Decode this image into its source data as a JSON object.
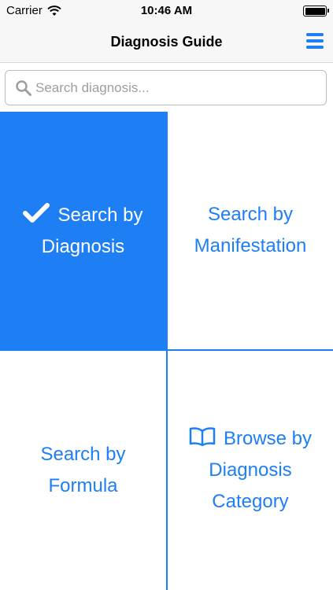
{
  "status_bar": {
    "carrier": "Carrier",
    "time": "10:46 AM",
    "wifi_icon": "wifi-icon",
    "battery_level": 1.0
  },
  "nav": {
    "title": "Diagnosis Guide",
    "menu_icon": "hamburger-menu-icon"
  },
  "search": {
    "placeholder": "Search diagnosis...",
    "value": "",
    "icon": "search-icon"
  },
  "tiles": [
    {
      "line1": "Search by",
      "line2": "Diagnosis",
      "icon": "checkmark-icon",
      "selected": true
    },
    {
      "line1": "Search by",
      "line2": "Manifestation",
      "selected": false
    },
    {
      "line1": "Search by",
      "line2": "Formula",
      "selected": false
    },
    {
      "line1": "Browse by",
      "line2": "Diagnosis",
      "line3": "Category",
      "icon": "book-icon",
      "selected": false
    }
  ],
  "colors": {
    "accent": "#1e7ff5",
    "selected_text": "#ffffff",
    "bar_background": "#f7f7f7"
  }
}
